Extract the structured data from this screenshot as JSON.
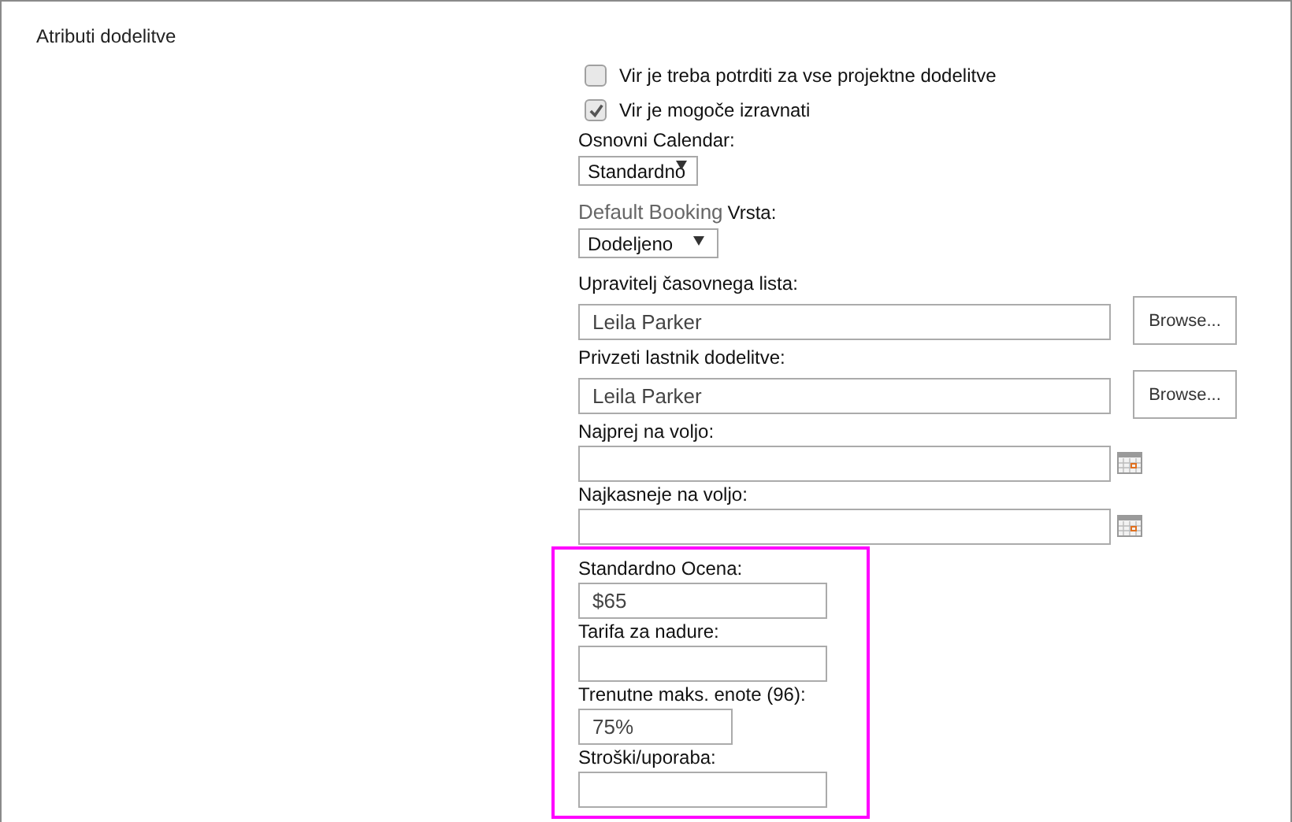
{
  "section": {
    "title": "Atributi dodelitve"
  },
  "fields": [
    {
      "kind": "checkbox",
      "label": "Vir je treba potrditi za vse projektne dodelitve",
      "checked": false
    },
    {
      "kind": "checkbox",
      "label": "Vir je mogoče izravnati",
      "checked": true
    },
    {
      "kind": "select",
      "label": "Osnovni Calendar:",
      "value": "Standardno"
    },
    {
      "kind": "select",
      "label": "Default Booking",
      "label_suffix": "Vrsta:",
      "value": "Dodeljeno"
    },
    {
      "kind": "lookup",
      "label": "Upravitelj časovnega lista:",
      "value": "Leila Parker",
      "button": "Browse..."
    },
    {
      "kind": "lookup",
      "label": "Privzeti lastnik dodelitve:",
      "value": "Leila Parker",
      "button": "Browse..."
    },
    {
      "kind": "date",
      "label": "Najprej na voljo:"
    },
    {
      "kind": "date",
      "label": "Najkasneje na voljo:"
    }
  ],
  "highlighted_fields": [
    {
      "kind": "text",
      "label": "Standardno Ocena:",
      "value": "$65"
    },
    {
      "kind": "text",
      "label": "Tarifa za nadure:"
    },
    {
      "kind": "short",
      "label": "Trenutne maks. enote (96):",
      "value": "75%"
    },
    {
      "kind": "text",
      "label": "Stroški/uporaba:"
    }
  ]
}
